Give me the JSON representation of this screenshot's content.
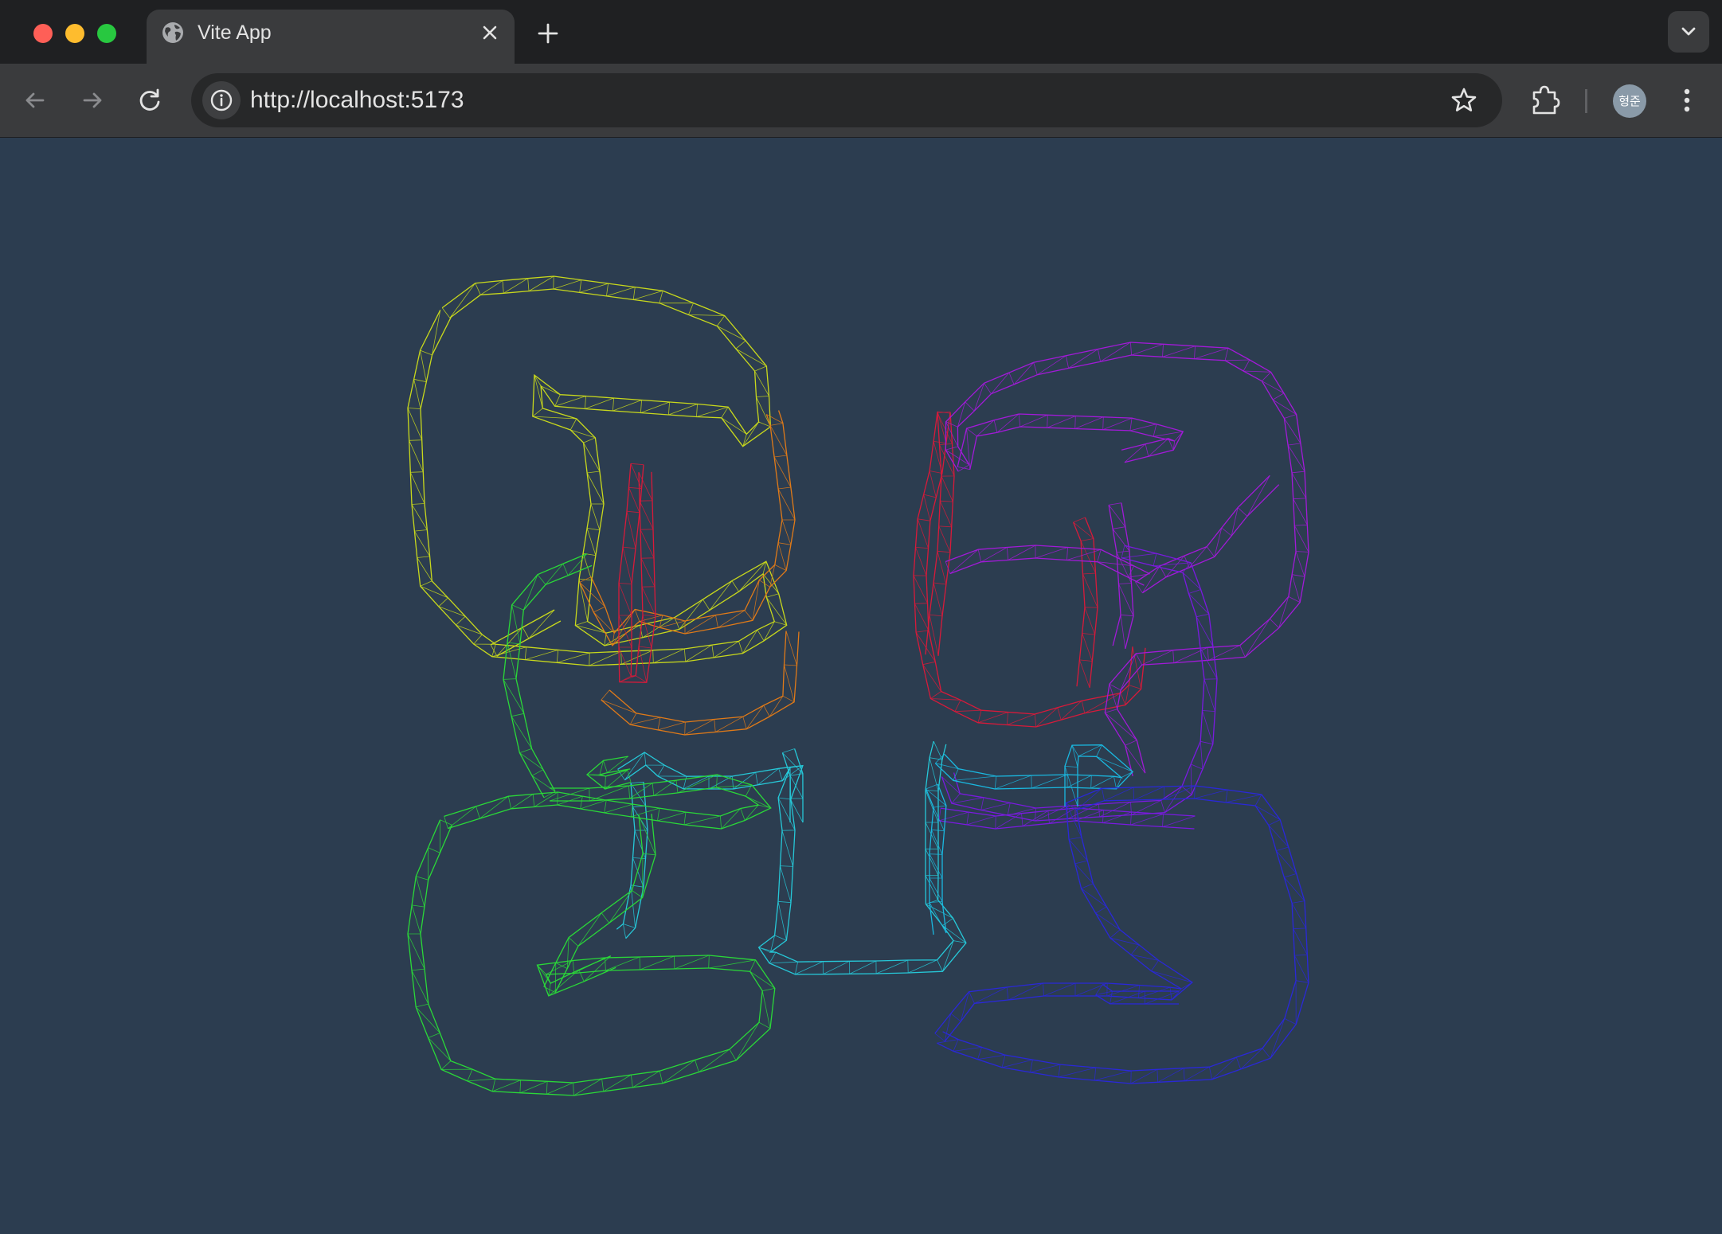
{
  "browser": {
    "tab": {
      "title": "Vite App",
      "favicon": "globe-icon"
    },
    "address_bar": {
      "url": "http://localhost:5173"
    },
    "profile": {
      "initials": "형준"
    },
    "icons": {
      "back": "arrow-left-icon",
      "forward": "arrow-right-icon",
      "reload": "reload-icon",
      "site_info": "info-icon",
      "bookmark": "star-icon",
      "extensions": "puzzle-icon",
      "menu": "kebab-menu-icon",
      "tab_search": "chevron-down-icon",
      "new_tab": "plus-icon",
      "close_tab": "close-icon"
    }
  },
  "canvas": {
    "background": "#2c3d50",
    "render_style": "wireframe tube mesh",
    "curve_colors": [
      "#c8d81c",
      "#e07a18",
      "#d81a3a",
      "#a21ad8",
      "#7a1ae0",
      "#26c8d8",
      "#1ab8e0",
      "#2ad838",
      "#2a28d8"
    ]
  }
}
